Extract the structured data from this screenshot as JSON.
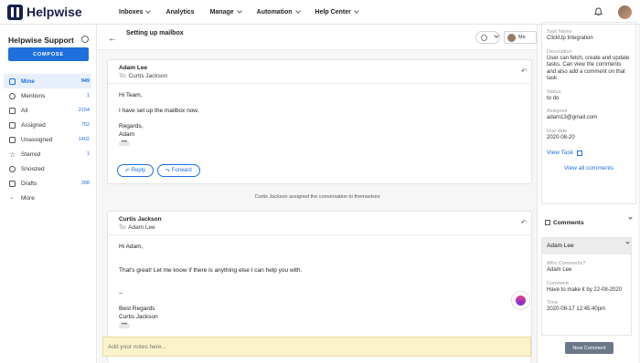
{
  "brand": {
    "name": "Helpwise"
  },
  "nav": [
    {
      "label": "Inboxes",
      "dropdown": true
    },
    {
      "label": "Analytics",
      "dropdown": false
    },
    {
      "label": "Manage",
      "dropdown": true
    },
    {
      "label": "Automation",
      "dropdown": true
    },
    {
      "label": "Help Center",
      "dropdown": true
    }
  ],
  "sidebar": {
    "title": "Helpwise Support",
    "compose_label": "COMPOSE",
    "items": [
      {
        "label": "Mine",
        "count": "949",
        "icon": "hand-icon",
        "active": true
      },
      {
        "label": "Mentions",
        "count": "1",
        "icon": "at-icon",
        "active": false
      },
      {
        "label": "All",
        "count": "2154",
        "icon": "mail-icon",
        "active": false
      },
      {
        "label": "Assigned",
        "count": "752",
        "icon": "mail-icon",
        "active": false
      },
      {
        "label": "Unassigned",
        "count": "1402",
        "icon": "mail-icon",
        "active": false
      },
      {
        "label": "Starred",
        "count": "1",
        "icon": "star-icon",
        "active": false
      },
      {
        "label": "Snoozed",
        "count": "",
        "icon": "clock-icon",
        "active": false
      },
      {
        "label": "Drafts",
        "count": "288",
        "icon": "document-icon",
        "active": false
      },
      {
        "label": "More",
        "count": "",
        "icon": "chevron-down-icon",
        "active": false
      }
    ]
  },
  "thread": {
    "subject": "Setting up mailbox",
    "me_label": "Me",
    "messages": [
      {
        "from": "Adam Lee",
        "to_label": "To:",
        "to": "Curtis Jackson",
        "lines": [
          "Hi Team,",
          "",
          "I have set up the mailbox now.",
          "",
          "Regards,",
          "Adam"
        ],
        "reply_label": "Reply",
        "forward_label": "Forward"
      },
      {
        "from": "Curtis Jackson",
        "to_label": "To:",
        "to": "Adam Lee",
        "lines": [
          "Hi Adam,",
          "",
          "That's great! Let me know if there is anything else I can help you with.",
          "",
          "--",
          "Best Regards",
          "Curtis Jackson"
        ]
      }
    ],
    "event": "Curtis Jackson assigned the conversation to themselves",
    "notes_placeholder": "Add your notes here..."
  },
  "task": {
    "name_label": "Task Name",
    "name": "ClickUp Integration",
    "description_label": "Description",
    "description": "User can fetch, create and update tasks. Can view the comments and also add a comment on that task",
    "status_label": "Status",
    "status": "to do",
    "assignee_label": "Assignee",
    "assignee": "adam13@gmail.com",
    "due_label": "Due date",
    "due": "2020-08-20",
    "view_task_label": "View Task",
    "view_comments_label": "View all comments"
  },
  "comments": {
    "title": "Comments",
    "card": {
      "author": "Adam Lee",
      "who_label": "Who Comments?",
      "who": "Adam Lee",
      "comment_label": "Comment",
      "comment": "Have to make it by 22-08-2020",
      "time_label": "Time",
      "time": "2020-08-17 12:45:40pm"
    },
    "new_comment_label": "New Comment"
  },
  "colors": {
    "accent": "#1f6fdc",
    "brand": "#1a1f4d",
    "notes_bg": "#fbf3c9"
  }
}
